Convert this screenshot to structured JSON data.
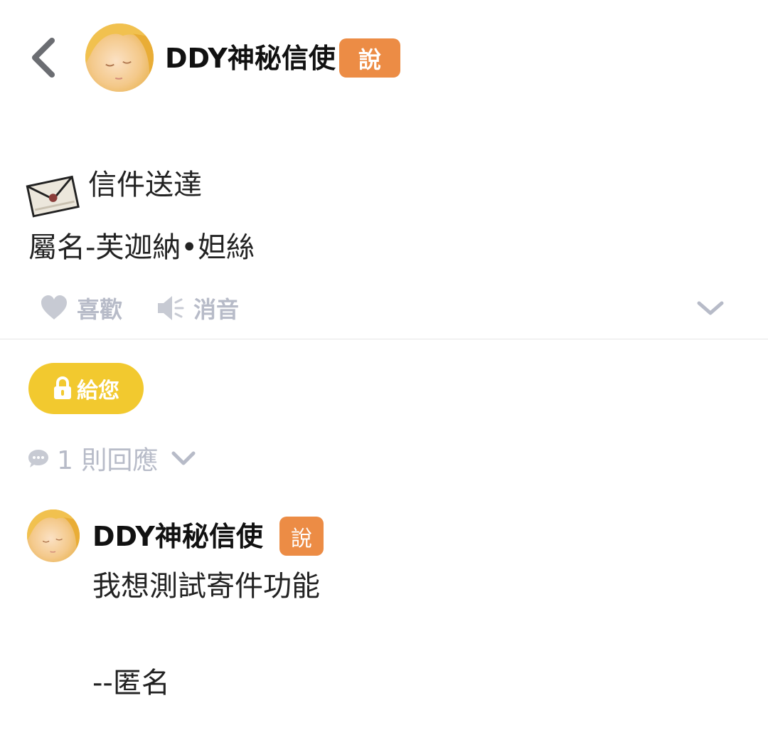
{
  "header": {
    "back_icon": "chevron-left-icon",
    "author_name": "DDY神秘信使",
    "badge": "說"
  },
  "post": {
    "icon": "letter-envelope-icon",
    "line1": "信件送達",
    "line2": "屬名-芙迦納•妲絲"
  },
  "actions": {
    "like_label": "喜歡",
    "like_icon": "heart-icon",
    "mute_label": "消音",
    "mute_icon": "speaker-icon",
    "more_icon": "chevron-down-icon"
  },
  "give_button": {
    "label": "給您",
    "icon": "lock-icon"
  },
  "replies": {
    "count_label": "1 則回應",
    "icon": "comment-bubble-icon",
    "items": [
      {
        "author_name": "DDY神秘信使",
        "badge": "說",
        "line1": "我想測試寄件功能",
        "line2": "--匿名"
      }
    ]
  },
  "colors": {
    "badge_orange": "#ec8c45",
    "give_yellow": "#f2c92f",
    "muted_gray": "#b7bbc8",
    "back_gray": "#6b6d72"
  }
}
